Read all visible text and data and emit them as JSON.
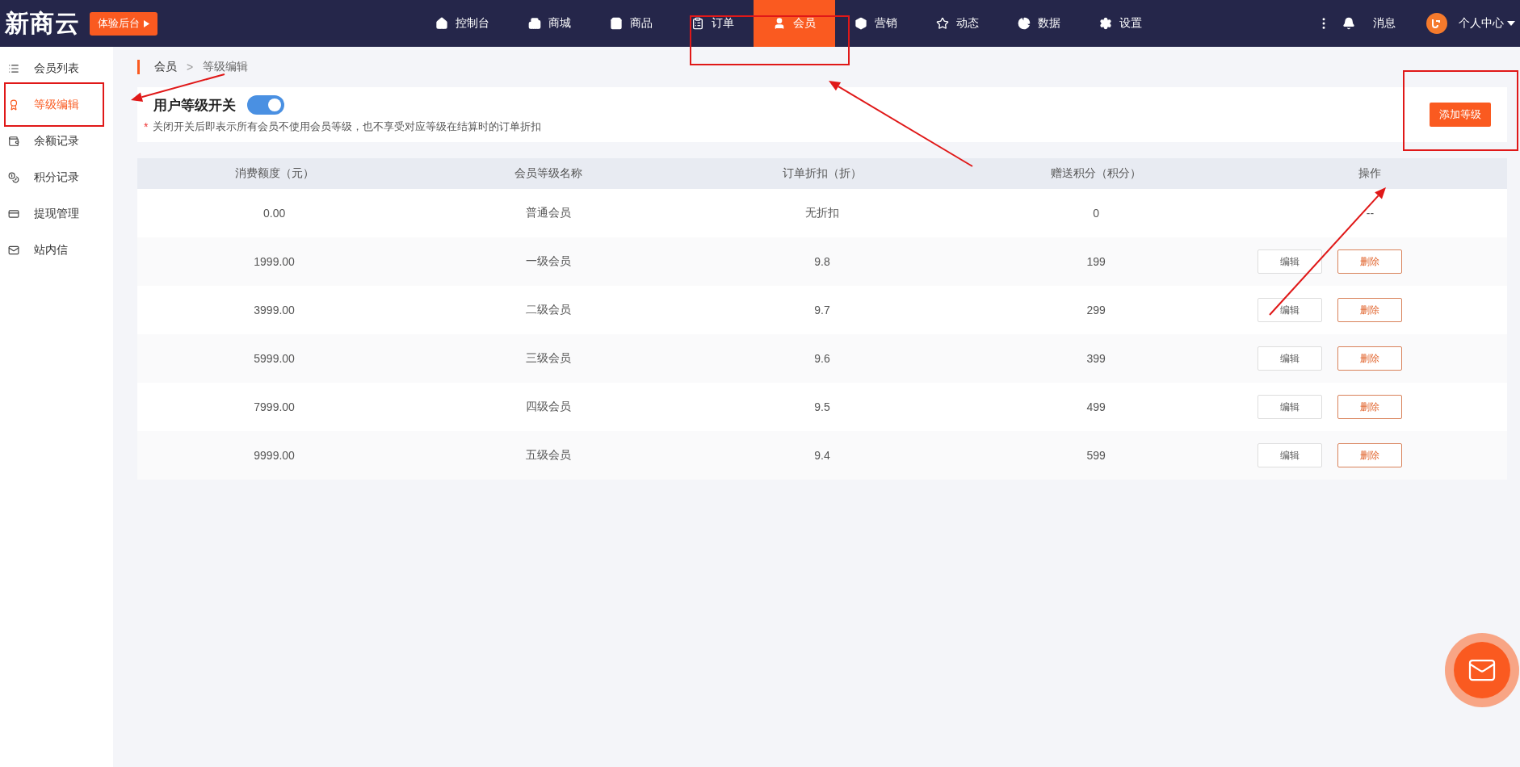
{
  "brand": {
    "logo": "新商云",
    "trial_button": "体验后台"
  },
  "nav": [
    {
      "label": "控制台",
      "selected": false
    },
    {
      "label": "商城",
      "selected": false
    },
    {
      "label": "商品",
      "selected": false
    },
    {
      "label": "订单",
      "selected": false
    },
    {
      "label": "会员",
      "selected": true
    },
    {
      "label": "营销",
      "selected": false
    },
    {
      "label": "动态",
      "selected": false
    },
    {
      "label": "数据",
      "selected": false
    },
    {
      "label": "设置",
      "selected": false
    }
  ],
  "header_right": {
    "messages": "消息",
    "profile": "个人中心"
  },
  "sidebar": {
    "items": [
      {
        "label": "会员列表",
        "selected": false
      },
      {
        "label": "等级编辑",
        "selected": true
      },
      {
        "label": "余额记录",
        "selected": false
      },
      {
        "label": "积分记录",
        "selected": false
      },
      {
        "label": "提现管理",
        "selected": false
      },
      {
        "label": "站内信",
        "selected": false
      }
    ]
  },
  "breadcrumb": {
    "items": [
      "会员",
      "等级编辑"
    ],
    "separator": ">"
  },
  "level_switch": {
    "label": "用户等级开关",
    "on": true,
    "note_mark": "*",
    "note": "关闭开关后即表示所有会员不使用会员等级，也不享受对应等级在结算时的订单折扣"
  },
  "add_button": "添加等级",
  "table": {
    "columns": [
      "消费额度（元）",
      "会员等级名称",
      "订单折扣（折）",
      "赠送积分（积分）",
      "操作"
    ],
    "rows": [
      {
        "amount": "0.00",
        "name": "普通会员",
        "discount": "无折扣",
        "points": "0",
        "empty_actions": "--"
      },
      {
        "amount": "1999.00",
        "name": "一级会员",
        "discount": "9.8",
        "points": "199",
        "actions": [
          "编辑",
          "删除"
        ]
      },
      {
        "amount": "3999.00",
        "name": "二级会员",
        "discount": "9.7",
        "points": "299",
        "actions": [
          "编辑",
          "删除"
        ]
      },
      {
        "amount": "5999.00",
        "name": "三级会员",
        "discount": "9.6",
        "points": "399",
        "actions": [
          "编辑",
          "删除"
        ]
      },
      {
        "amount": "7999.00",
        "name": "四级会员",
        "discount": "9.5",
        "points": "499",
        "actions": [
          "编辑",
          "删除"
        ]
      },
      {
        "amount": "9999.00",
        "name": "五级会员",
        "discount": "9.4",
        "points": "599",
        "actions": [
          "编辑",
          "删除"
        ]
      }
    ]
  }
}
